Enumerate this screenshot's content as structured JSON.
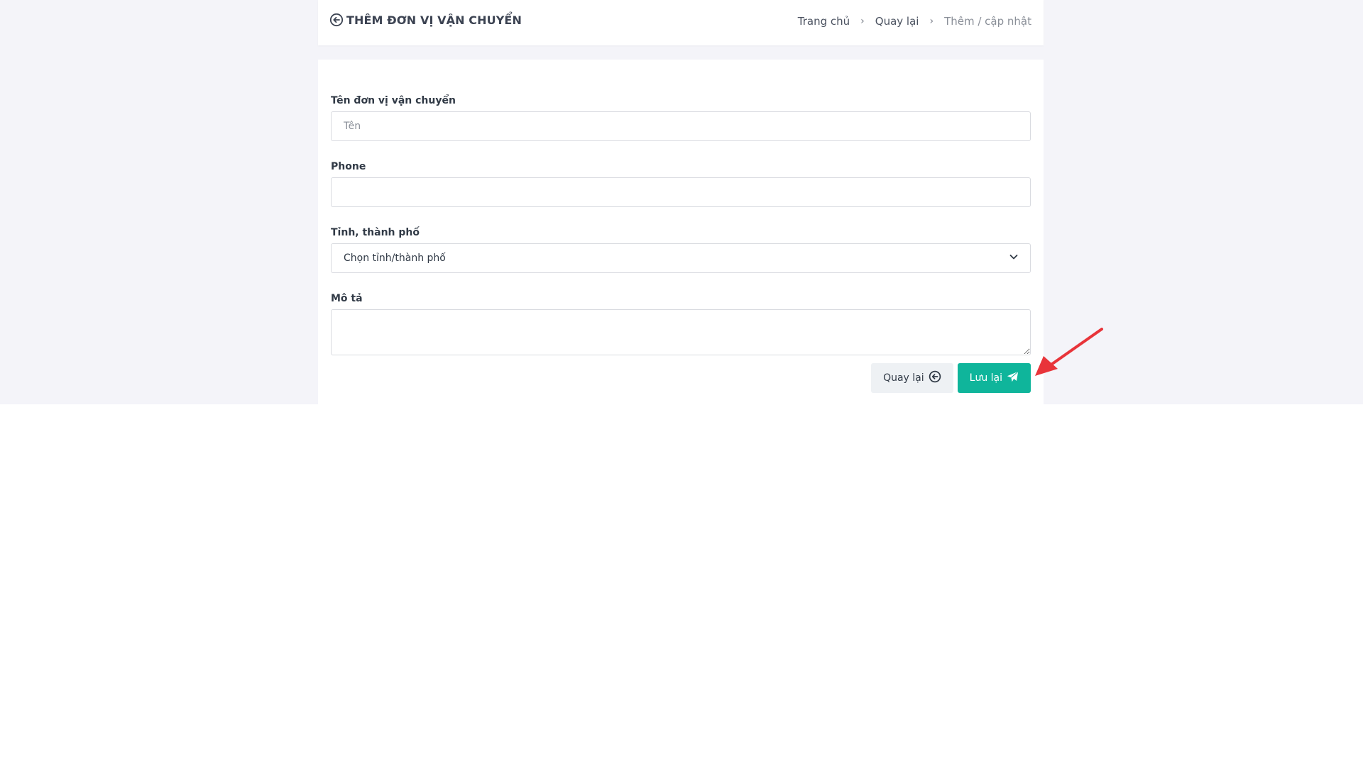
{
  "header": {
    "title": "THÊM ĐƠN VỊ VẬN CHUYỂN",
    "breadcrumb": {
      "home": "Trang chủ",
      "back": "Quay lại",
      "current": "Thêm / cập nhật"
    }
  },
  "form": {
    "name": {
      "label": "Tên đơn vị vận chuyển",
      "placeholder": "Tên",
      "value": ""
    },
    "phone": {
      "label": "Phone",
      "placeholder": "",
      "value": ""
    },
    "province": {
      "label": "Tỉnh, thành phố",
      "selected": "Chọn tỉnh/thành phố"
    },
    "description": {
      "label": "Mô tả",
      "value": ""
    }
  },
  "actions": {
    "back_label": "Quay lại",
    "save_label": "Lưu lại"
  },
  "colors": {
    "accent": "#0fb59b",
    "annotation": "#e8343a",
    "page_bg": "#f4f4f9"
  }
}
